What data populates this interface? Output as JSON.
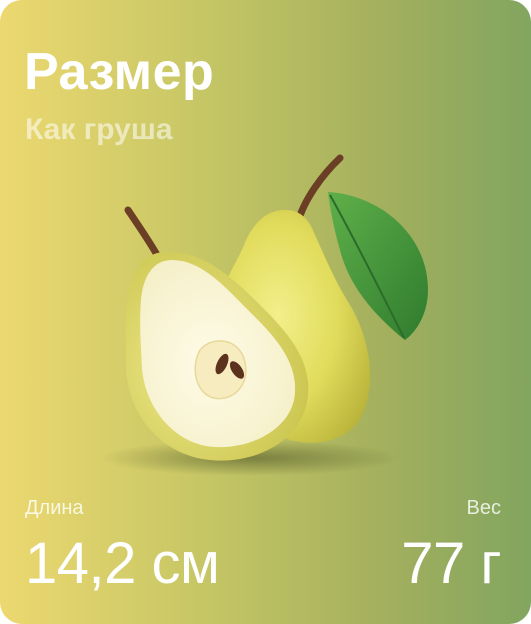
{
  "card": {
    "title": "Размер",
    "subtitle": "Как груша",
    "illustration_icon": "pear-icon",
    "stats": {
      "length": {
        "label": "Длина",
        "value": "14,2 см"
      },
      "weight": {
        "label": "Вес",
        "value": "77 г"
      }
    }
  },
  "colors": {
    "gradient_start": "#ecd870",
    "gradient_end": "#82a55f",
    "text": "#ffffff"
  }
}
